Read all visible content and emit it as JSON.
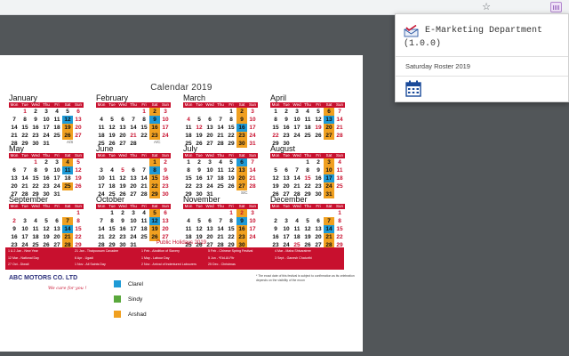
{
  "topbar": {
    "star_icon": "star-icon",
    "extension_icon": "calendar-extension-icon"
  },
  "popup": {
    "title": "E-Marketing Department",
    "version": "(1.0.0)",
    "link": "Saturday Roster 2019",
    "brand_color": "#1a4a9a"
  },
  "calendar": {
    "title": "Calendar 2019",
    "day_headers": [
      "Mon",
      "Tue",
      "Wed",
      "Thu",
      "Fri",
      "Sat",
      "Sun"
    ],
    "months": [
      {
        "name": "January",
        "offset": 1,
        "days": 31,
        "blue": [
          12
        ],
        "green": [],
        "orange": [
          19,
          26
        ],
        "red": [
          1
        ],
        "note": "A/S"
      },
      {
        "name": "February",
        "offset": 4,
        "days": 28,
        "blue": [
          9
        ],
        "green": [],
        "orange": [
          2,
          16,
          23
        ],
        "red": [
          1,
          21
        ],
        "note": "A/C"
      },
      {
        "name": "March",
        "offset": 4,
        "days": 31,
        "blue": [
          16
        ],
        "green": [],
        "orange": [
          2,
          9,
          23,
          30
        ],
        "red": [
          4,
          12
        ],
        "note": ""
      },
      {
        "name": "April",
        "offset": 0,
        "days": 30,
        "blue": [
          13
        ],
        "green": [],
        "orange": [
          6,
          20,
          27
        ],
        "red": [
          19,
          22
        ],
        "note": ""
      },
      {
        "name": "May",
        "offset": 2,
        "days": 31,
        "blue": [
          11
        ],
        "green": [],
        "orange": [
          4,
          25
        ],
        "red": [
          1
        ],
        "note": ""
      },
      {
        "name": "June",
        "offset": 5,
        "days": 30,
        "blue": [
          8
        ],
        "green": [],
        "orange": [
          1,
          15,
          22,
          29
        ],
        "red": [
          5
        ],
        "note": ""
      },
      {
        "name": "July",
        "offset": 0,
        "days": 31,
        "blue": [
          6
        ],
        "green": [],
        "orange": [
          13,
          20,
          27
        ],
        "red": [],
        "note": "S/C"
      },
      {
        "name": "August",
        "offset": 3,
        "days": 31,
        "blue": [
          17
        ],
        "green": [],
        "orange": [
          3,
          10,
          24,
          31
        ],
        "red": [
          15
        ],
        "note": ""
      },
      {
        "name": "September",
        "offset": 6,
        "days": 30,
        "blue": [
          14
        ],
        "green": [],
        "orange": [
          7,
          21,
          28
        ],
        "red": [
          2
        ],
        "note": ""
      },
      {
        "name": "October",
        "offset": 1,
        "days": 31,
        "blue": [
          12
        ],
        "green": [],
        "orange": [
          5,
          19,
          26
        ],
        "red": [
          27
        ],
        "note": ""
      },
      {
        "name": "November",
        "offset": 4,
        "days": 30,
        "blue": [
          9
        ],
        "green": [],
        "orange": [
          2,
          16,
          23,
          30
        ],
        "red": [
          1,
          2
        ],
        "note": ""
      },
      {
        "name": "December",
        "offset": 6,
        "days": 31,
        "blue": [
          14
        ],
        "green": [],
        "orange": [
          7,
          21,
          28
        ],
        "red": [
          25
        ],
        "note": ""
      }
    ]
  },
  "holidays": {
    "title": "Public Holidays 2019",
    "items": [
      "1 & 2 Jan - New Year",
      "21 Jan - Thaipoosam Cavadee",
      "1 Feb - Abolition of Slavery",
      "5 Feb - Chinese Spring Festival",
      "4 Mar - Maha Shivaratree",
      "12 Mar - National Day",
      "6 Apr - Ugadi",
      "1 May - Labour Day",
      "5 Jun - *Eid-Ul-Fitr",
      "3 Sept - Ganesh Chaturthi",
      "27 Oct - Diwali",
      "1 Nov - All Saints Day",
      "2 Nov - Arrival of Indentured Labourers",
      "25 Dec - Christmas",
      ""
    ],
    "footnote": "* The exact date of this festival is subject to confirmation as its celebration depends on the visibility of the moon"
  },
  "company": {
    "name": "ABC MOTORS CO. LTD",
    "tagline": "We care for you !"
  },
  "legend": [
    {
      "name": "Clarel",
      "color": "#1e9ad6"
    },
    {
      "name": "Sindy",
      "color": "#5aa83c"
    },
    {
      "name": "Arshad",
      "color": "#f0a020"
    }
  ]
}
